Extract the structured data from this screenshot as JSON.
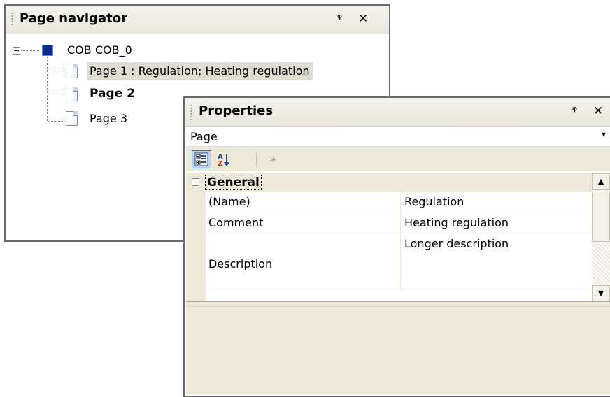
{
  "navigator": {
    "title": "Page navigator",
    "pin_icon": "pin-icon",
    "close_icon": "close-icon",
    "pin_glyph": "ᵠ",
    "close_glyph": "✕",
    "root": {
      "label": "COB COB_0",
      "expander": "−"
    },
    "pages": [
      {
        "label": "Page 1 : Regulation; Heating regulation",
        "selected": true,
        "bold": false
      },
      {
        "label": "Page 2",
        "selected": false,
        "bold": true
      },
      {
        "label": "Page 3",
        "selected": false,
        "bold": false
      }
    ]
  },
  "properties": {
    "title": "Properties",
    "pin_glyph": "ᵠ",
    "close_glyph": "✕",
    "object_selector": {
      "value": "Page",
      "arrow": "▾"
    },
    "toolbar": {
      "categorized_icon": "categorized-icon",
      "alphabetical_icon": "sort-az-icon",
      "more_glyph": "»"
    },
    "category": {
      "label": "General",
      "expander": "−"
    },
    "rows": [
      {
        "name": "(Name)",
        "value": "Regulation"
      },
      {
        "name": "Comment",
        "value": "Heating regulation"
      },
      {
        "name": "Description",
        "value": "Longer description"
      }
    ],
    "scroll_up": "▲",
    "scroll_down": "▼"
  },
  "colors": {
    "selection": "#e0ddd3",
    "panel_border": "#6b6b6b",
    "titlebar": "#ece9d8",
    "toolbar_active": "#c1d2ee"
  }
}
